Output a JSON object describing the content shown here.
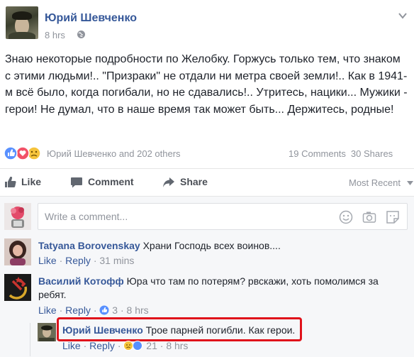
{
  "post": {
    "author": "Юрий Шевченко",
    "time": "8 hrs",
    "text": "Знаю некоторые подробности по Желобку. Горжусь только тем, что знаком с этими людьми!.. \"Призраки\" не отдали ни метра своей земли!.. Как в 1941-м всё было, когда погибали, но не сдавались!.. Утритесь, нацики... Мужики - герои! Не думал, что в наше время так может быть... Держитесь, родные!",
    "reactions_text": "Юрий Шевченко and 202 others",
    "comments_count": "19 Comments",
    "shares_count": "30 Shares"
  },
  "actions": {
    "like": "Like",
    "comment": "Comment",
    "share": "Share",
    "sort": "Most Recent"
  },
  "composer": {
    "placeholder": "Write a comment..."
  },
  "comments": [
    {
      "author": "Tatyana Borovenskay",
      "text": "Храни Господь всех воинов....",
      "like": "Like",
      "reply": "Reply",
      "time": "31 mins"
    },
    {
      "author": "Василий Котофф",
      "text": "Юра что там по потерям? рвскажи, хоть помолимся за ребят.",
      "like": "Like",
      "reply": "Reply",
      "reactions": "3",
      "time": "8 hrs"
    }
  ],
  "reply": {
    "author": "Юрий Шевченко",
    "text": "Трое парней погибли. Как герои.",
    "like": "Like",
    "reply": "Reply",
    "reactions": "21",
    "time": "8 hrs"
  },
  "colors": {
    "link_blue": "#365899",
    "like_blue": "#5890ff",
    "love_red": "#f25268",
    "sad_yellow": "#f5c33b",
    "highlight_red": "#e0121b"
  }
}
